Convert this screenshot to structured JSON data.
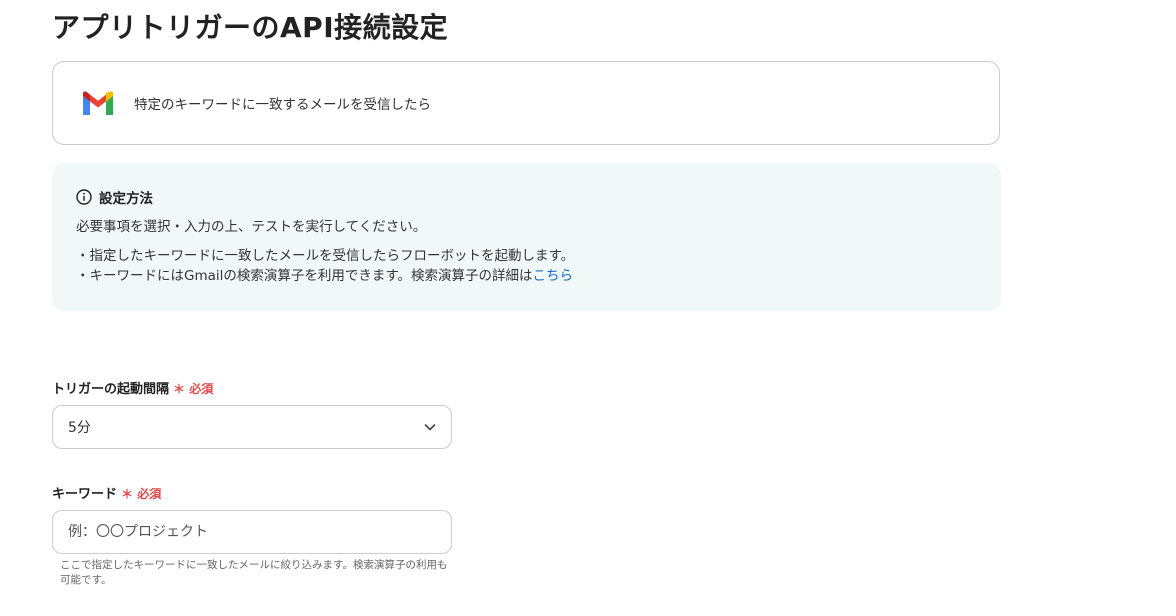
{
  "page": {
    "title": "アプリトリガーのAPI接続設定"
  },
  "trigger": {
    "icon": "gmail-icon",
    "label": "特定のキーワードに一致するメールを受信したら"
  },
  "info": {
    "icon": "info-icon",
    "heading": "設定方法",
    "line1": "必要事項を選択・入力の上、テストを実行してください。",
    "line2": "・指定したキーワードに一致したメールを受信したらフローボットを起動します。",
    "line3_prefix": "・キーワードにはGmailの検索演算子を利用できます。検索演算子の詳細は",
    "line3_link": "こちら",
    "link_color": "#1769c9"
  },
  "fields": {
    "interval": {
      "label": "トリガーの起動間隔",
      "required": "＊ 必須",
      "value": "5分"
    },
    "keyword": {
      "label": "キーワード",
      "required": "＊ 必須",
      "placeholder": "例：〇〇プロジェクト",
      "value": "",
      "help": "ここで指定したキーワードに一致したメールに絞り込みます。検索演算子の利用も可能です。"
    }
  },
  "colors": {
    "required": "#e04a4a",
    "info_bg": "#f1f9f8"
  }
}
